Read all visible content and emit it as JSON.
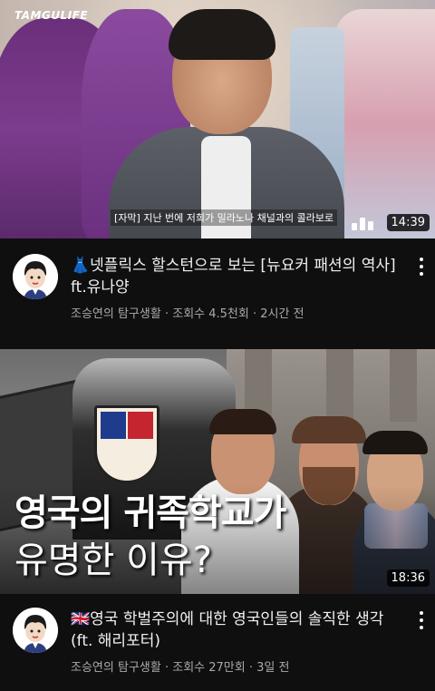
{
  "videos": [
    {
      "title_emoji": "👗",
      "title": "넷플릭스 할스턴으로 보는 [뉴요커 패션의 역사] ft.유나양",
      "channel": "조승연의 탐구생활",
      "views": "조회수 4.5천회",
      "age": "2시간 전",
      "duration": "14:39",
      "thumbnail": {
        "watermark": "TAMGULIFE",
        "caption": "[자막] 지난 번에 저희가 밀라노나 채널과의 콜라보로"
      }
    },
    {
      "title_emoji": "🇬🇧",
      "title": "영국 학벌주의에 대한 영국인들의 솔직한 생각 (ft. 해리포터)",
      "channel": "조승연의 탐구생활",
      "views": "조회수 27만회",
      "age": "3일 전",
      "duration": "18:36",
      "thumbnail": {
        "headline_1": "영국의 귀족학교가",
        "headline_2": "유명한 이유?"
      }
    }
  ],
  "separator": "·",
  "icons": {
    "avatar": "channel-avatar-cartoon",
    "more": "more-vertical-icon",
    "sound_bars": "audio-bars-icon"
  },
  "colors": {
    "background": "#0f0f0f",
    "text_primary": "#f1f1f1",
    "text_secondary": "#aaaaaa"
  }
}
